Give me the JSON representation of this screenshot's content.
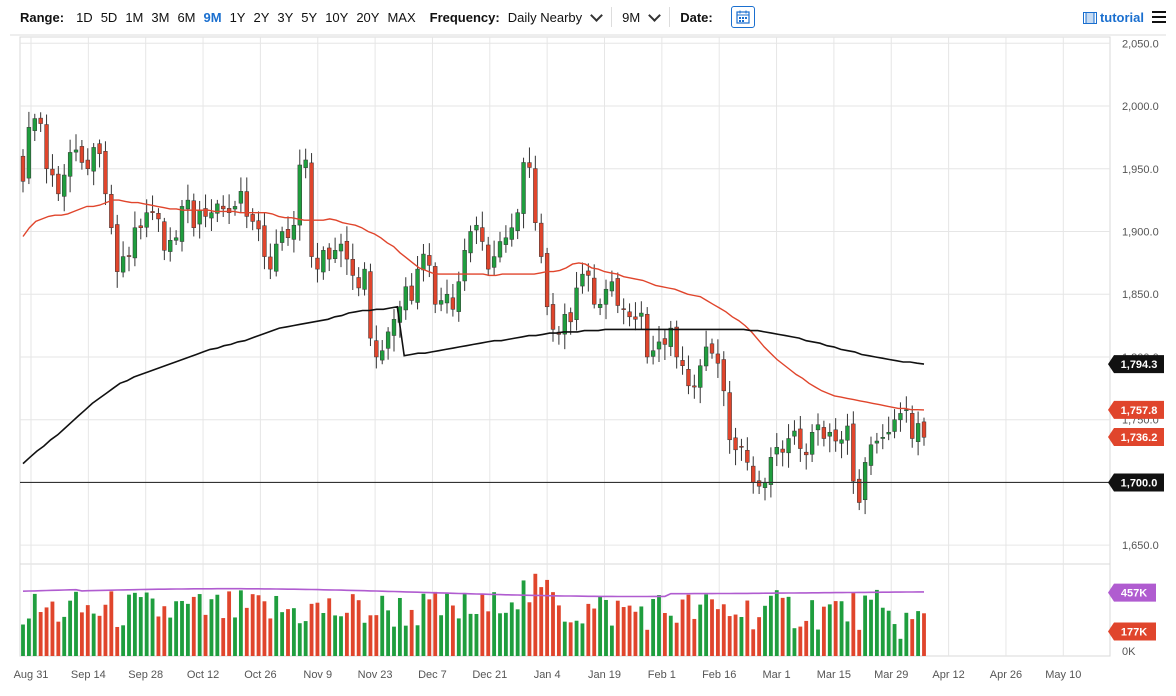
{
  "toolbar": {
    "range_label": "Range:",
    "ranges": [
      "1D",
      "5D",
      "1M",
      "3M",
      "6M",
      "9M",
      "1Y",
      "2Y",
      "3Y",
      "5Y",
      "10Y",
      "20Y",
      "MAX"
    ],
    "active_range": "9M",
    "frequency_label": "Frequency:",
    "frequency_value": "Daily Nearby",
    "period_value": "9M",
    "date_label": "Date:",
    "tutorial_label": "tutorial",
    "calendar_icon": "calendar-icon",
    "menu_icon": "hamburger-menu-icon"
  },
  "colors": {
    "up": "#1f9e3e",
    "down": "#e0452c",
    "ma_short": "#e0452c",
    "ma_long": "#111111",
    "volume_avg": "#b05cd0",
    "accent": "#1a6fcf",
    "hline": "#333333"
  },
  "chart_data": {
    "type": "candlestick",
    "x_ticks": [
      "Aug 31",
      "Sep 14",
      "Sep 28",
      "Oct 12",
      "Oct 26",
      "Nov 9",
      "Nov 23",
      "Dec 7",
      "Dec 21",
      "Jan 4",
      "Jan 19",
      "Feb 1",
      "Feb 16",
      "Mar 1",
      "Mar 15",
      "Mar 29",
      "Apr 12",
      "Apr 26",
      "May 10"
    ],
    "price_ticks": [
      "2,050.0",
      "2,000.0",
      "1,950.0",
      "1,900.0",
      "1,850.0",
      "1,800.0",
      "1,750.0",
      "1,700.0",
      "1,650.0"
    ],
    "ylim": [
      1635,
      2055
    ],
    "price_labels": [
      {
        "text": "1,794.3",
        "value": 1794.3,
        "style": "black"
      },
      {
        "text": "1,757.8",
        "value": 1757.8,
        "style": "red"
      },
      {
        "text": "1,736.2",
        "value": 1736.2,
        "style": "red"
      },
      {
        "text": "1,700.0",
        "value": 1700.0,
        "style": "black"
      }
    ],
    "horizontal_line": 1700.0,
    "closes": [
      1940,
      1983,
      1990,
      1986,
      1950,
      1945,
      1930,
      1945,
      1963,
      1965,
      1955,
      1950,
      1967,
      1962,
      1930,
      1903,
      1868,
      1880,
      1880,
      1903,
      1903,
      1915,
      1915,
      1910,
      1885,
      1893,
      1895,
      1920,
      1925,
      1903,
      1917,
      1912,
      1915,
      1922,
      1918,
      1915,
      1920,
      1932,
      1912,
      1908,
      1902,
      1880,
      1870,
      1890,
      1900,
      1895,
      1905,
      1953,
      1957,
      1880,
      1870,
      1885,
      1878,
      1885,
      1890,
      1878,
      1865,
      1855,
      1870,
      1815,
      1800,
      1805,
      1820,
      1830,
      1840,
      1856,
      1845,
      1870,
      1882,
      1873,
      1842,
      1845,
      1850,
      1838,
      1860,
      1885,
      1900,
      1905,
      1892,
      1870,
      1880,
      1892,
      1895,
      1903,
      1915,
      1955,
      1951,
      1907,
      1880,
      1840,
      1822,
      1818,
      1834,
      1828,
      1855,
      1866,
      1865,
      1842,
      1842,
      1854,
      1860,
      1841,
      1838,
      1832,
      1830,
      1835,
      1800,
      1805,
      1812,
      1810,
      1823,
      1800,
      1793,
      1777,
      1776,
      1793,
      1808,
      1803,
      1795,
      1773,
      1734,
      1726,
      1728,
      1716,
      1700,
      1697,
      1700,
      1720,
      1728,
      1724,
      1735,
      1741,
      1727,
      1722,
      1740,
      1746,
      1735,
      1740,
      1733,
      1734,
      1745,
      1701,
      1684,
      1716,
      1730,
      1733,
      1736,
      1740,
      1750,
      1755,
      1758,
      1735,
      1747,
      1736
    ],
    "ma50": [
      1896,
      1903,
      1908,
      1910,
      1912,
      1913,
      1913,
      1914,
      1916,
      1918,
      1920,
      1920,
      1921,
      1923,
      1925,
      1925,
      1924,
      1923,
      1923,
      1922,
      1921,
      1920,
      1919,
      1918,
      1918,
      1917,
      1917,
      1917,
      1917,
      1917,
      1916,
      1916,
      1916,
      1916,
      1915,
      1915,
      1915,
      1915,
      1915,
      1914,
      1912,
      1911,
      1911,
      1910,
      1909,
      1909,
      1909,
      1909,
      1910,
      1909,
      1907,
      1906,
      1905,
      1903,
      1900,
      1898,
      1895,
      1891,
      1888,
      1883,
      1879,
      1875,
      1871,
      1869,
      1867,
      1866,
      1866,
      1866,
      1866,
      1866,
      1866,
      1866,
      1866,
      1865,
      1865,
      1866,
      1866,
      1866,
      1866,
      1866,
      1866,
      1867,
      1868,
      1868,
      1869,
      1871,
      1874,
      1875,
      1874,
      1871,
      1870,
      1868,
      1867,
      1866,
      1864,
      1863,
      1862,
      1861,
      1859,
      1857,
      1856,
      1855,
      1854,
      1852,
      1850,
      1849,
      1848,
      1845,
      1842,
      1839,
      1836,
      1832,
      1829,
      1825,
      1820,
      1814,
      1808,
      1803,
      1798,
      1794,
      1790,
      1786,
      1783,
      1779,
      1776,
      1773,
      1771,
      1769,
      1768,
      1767,
      1766,
      1765,
      1764,
      1763,
      1762,
      1761,
      1760,
      1759,
      1759,
      1758,
      1758,
      1757.8
    ],
    "ma200": [
      1715,
      1720,
      1725,
      1729,
      1734,
      1738,
      1743,
      1748,
      1753,
      1758,
      1763,
      1767,
      1771,
      1775,
      1779,
      1781,
      1784,
      1786,
      1788,
      1790,
      1792,
      1794,
      1796,
      1798,
      1800,
      1802,
      1804,
      1806,
      1807,
      1809,
      1810,
      1812,
      1813,
      1815,
      1817,
      1819,
      1821,
      1823,
      1824,
      1825,
      1826,
      1827,
      1828,
      1829,
      1830,
      1832,
      1833,
      1835,
      1836,
      1837,
      1837,
      1838,
      1838,
      1839,
      1840,
      1801,
      1802,
      1803,
      1803,
      1804,
      1805,
      1806,
      1807,
      1808,
      1809,
      1810,
      1811,
      1812,
      1813,
      1813,
      1814,
      1815,
      1816,
      1817,
      1817,
      1818,
      1819,
      1819,
      1820,
      1820,
      1820,
      1821,
      1821,
      1821,
      1822,
      1822,
      1822,
      1822,
      1822,
      1822,
      1822,
      1822,
      1822,
      1822,
      1822,
      1822,
      1822,
      1822,
      1822,
      1822,
      1822,
      1822,
      1822,
      1822,
      1822,
      1821,
      1821,
      1820,
      1819,
      1818,
      1817,
      1816,
      1815,
      1813,
      1812,
      1811,
      1809,
      1808,
      1806,
      1805,
      1804,
      1802,
      1801,
      1800,
      1799,
      1798,
      1797,
      1796,
      1796,
      1795,
      1794.3
    ],
    "volume": {
      "labels": [
        {
          "text": "457K",
          "value": 457,
          "style": "purple"
        },
        {
          "text": "177K",
          "value": 177,
          "style": "red"
        },
        {
          "text": "0K",
          "value": 0,
          "style": "plain"
        }
      ],
      "max": 620,
      "avg_value": 457
    }
  }
}
